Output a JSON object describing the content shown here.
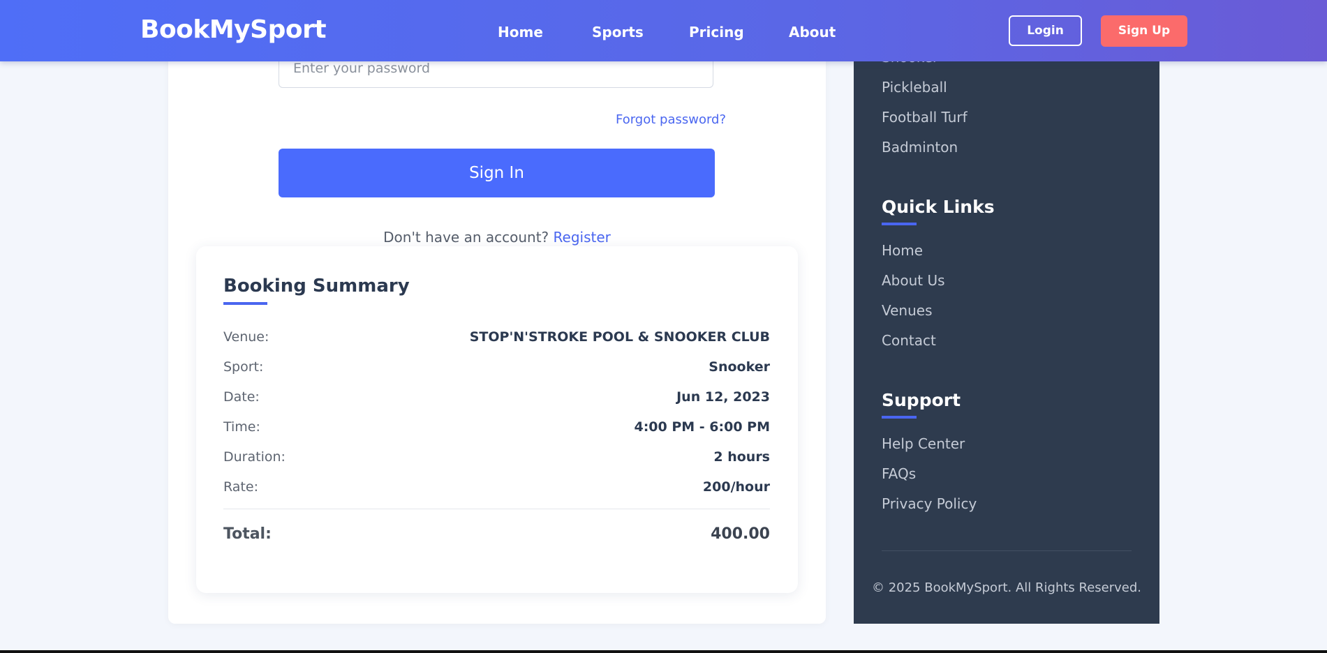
{
  "navbar": {
    "brand": "BookMySport",
    "links": [
      "Home",
      "Sports",
      "Pricing",
      "About"
    ],
    "login_label": "Login",
    "signup_label": "Sign Up"
  },
  "login_form": {
    "password_placeholder": "Enter your password",
    "forgot_password": "Forgot password?",
    "signin_label": "Sign In",
    "register_prompt": "Don't have an account?",
    "register_link": "Register"
  },
  "booking_summary": {
    "title": "Booking Summary",
    "rows": [
      {
        "label": "Venue:",
        "value": "STOP'N'STROKE POOL & SNOOKER CLUB"
      },
      {
        "label": "Sport:",
        "value": "Snooker"
      },
      {
        "label": "Date:",
        "value": "Jun 12, 2023"
      },
      {
        "label": "Time:",
        "value": "4:00 PM - 6:00 PM"
      },
      {
        "label": "Duration:",
        "value": "2 hours"
      },
      {
        "label": "Rate:",
        "value": "200/hour"
      }
    ],
    "total_label": "Total:",
    "total_value": "400.00"
  },
  "sidebar": {
    "sports_items": [
      "Snooker",
      "Pickleball",
      "Football Turf",
      "Badminton"
    ],
    "quick_links_heading": "Quick Links",
    "quick_links": [
      "Home",
      "About Us",
      "Venues",
      "Contact"
    ],
    "support_heading": "Support",
    "support_links": [
      "Help Center",
      "FAQs",
      "Privacy Policy"
    ],
    "copyright": "© 2025 BookMySport. All Rights Reserved."
  },
  "colors": {
    "accent": "#4a66f0",
    "signup": "#fb6b6b",
    "sidebar_bg": "#2e3b4e"
  }
}
